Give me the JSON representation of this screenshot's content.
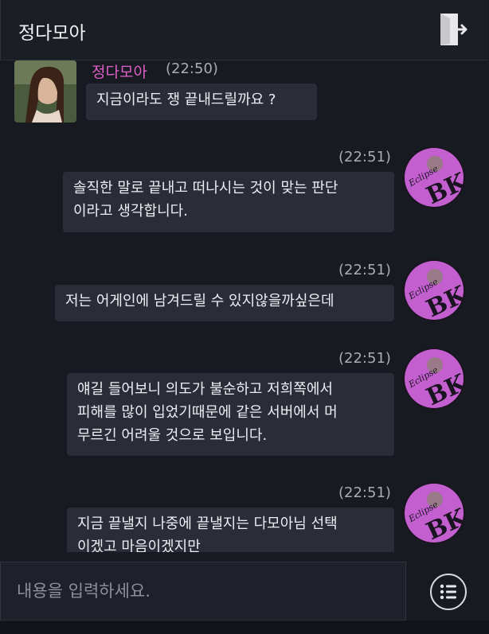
{
  "header": {
    "title": "정다모아",
    "exit_icon": "exit-door-icon"
  },
  "messages": [
    {
      "side": "left",
      "sender": "정다모아",
      "time": "(22:50)",
      "text": "지금이라도 쟁 끝내드릴까요 ?",
      "avatar": "character-portrait-avatar"
    },
    {
      "side": "right",
      "time": "(22:51)",
      "text": "솔직한 말로 끝내고 떠나시는 것이 맞는 판단\n이라고 생각합니다.",
      "avatar": "eclipse-bk-avatar"
    },
    {
      "side": "right",
      "time": "(22:51)",
      "text": "저는 어게인에 남겨드릴 수 있지않을까싶은데",
      "avatar": "eclipse-bk-avatar"
    },
    {
      "side": "right",
      "time": "(22:51)",
      "text": "얘길 들어보니 의도가 불순하고 저희쪽에서\n피해를 많이 입었기때문에 같은 서버에서 머\n무르긴 어려울 것으로 보입니다.",
      "avatar": "eclipse-bk-avatar"
    },
    {
      "side": "right",
      "time": "(22:51)",
      "text": "지금 끝낼지 나중에 끝낼지는 다모아님 선택\n이겠고 마음이겠지만",
      "avatar": "eclipse-bk-avatar"
    }
  ],
  "avatar_text": {
    "small": "Eclipse",
    "large": "BK"
  },
  "input": {
    "placeholder": "내용을 입력하세요.",
    "value": ""
  },
  "menu_icon": "list-menu-icon",
  "colors": {
    "background": "#171a21",
    "bubble": "#2a2d38",
    "sender_name": "#e05ec8",
    "avatar_purple": "#c45fd0"
  }
}
